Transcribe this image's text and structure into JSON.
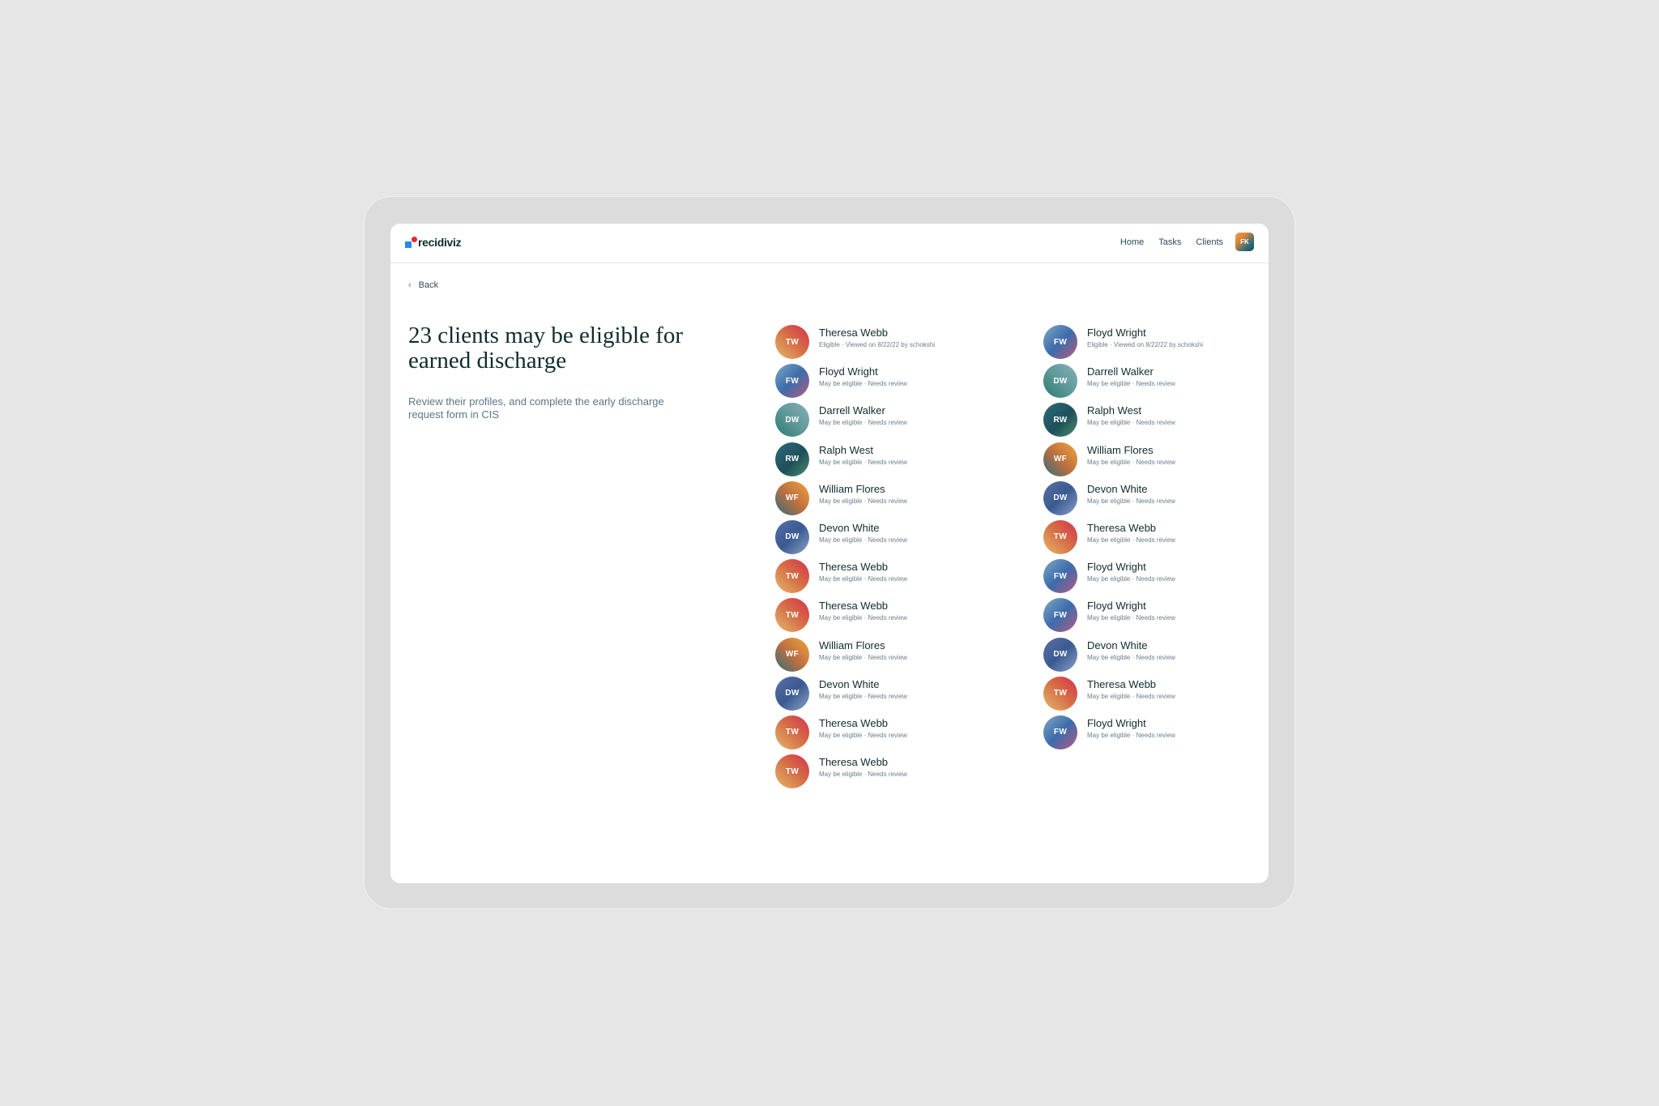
{
  "header": {
    "logo_text": "recidiviz",
    "nav": [
      {
        "label": "Home"
      },
      {
        "label": "Tasks"
      },
      {
        "label": "Clients"
      }
    ],
    "user_initials": "FK"
  },
  "back_label": "Back",
  "headline": "23 clients may be eligible for earned discharge",
  "subtext": "Review their profiles, and complete the early discharge request form in CIS",
  "clients_left": [
    {
      "initials": "TW",
      "name": "Theresa Webb",
      "status": "Eligible · Viewed on 8/22/22 by schokshi"
    },
    {
      "initials": "FW",
      "name": "Floyd Wright",
      "status": "May be eligible · Needs review"
    },
    {
      "initials": "DW",
      "name": "Darrell Walker",
      "status": "May be eligible · Needs review"
    },
    {
      "initials": "RW",
      "name": "Ralph West",
      "status": "May be eligible · Needs review"
    },
    {
      "initials": "WF",
      "name": "William Flores",
      "status": "May be eligible · Needs review"
    },
    {
      "initials": "DW",
      "name": "Devon White",
      "status": "May be eligible · Needs review"
    },
    {
      "initials": "TW",
      "name": "Theresa Webb",
      "status": "May be eligible · Needs review"
    },
    {
      "initials": "TW",
      "name": "Theresa Webb",
      "status": "May be eligible · Needs review"
    },
    {
      "initials": "WF",
      "name": "William Flores",
      "status": "May be eligible · Needs review"
    },
    {
      "initials": "DW",
      "name": "Devon White",
      "status": "May be eligible · Needs review"
    },
    {
      "initials": "TW",
      "name": "Theresa Webb",
      "status": "May be eligible · Needs review"
    },
    {
      "initials": "TW",
      "name": "Theresa Webb",
      "status": "May be eligible · Needs review"
    }
  ],
  "clients_right": [
    {
      "initials": "FW",
      "name": "Floyd Wright",
      "status": "Eligible · Viewed on 8/22/22 by schokshi"
    },
    {
      "initials": "DW",
      "name": "Darrell Walker",
      "status": "May be eligible · Needs review"
    },
    {
      "initials": "RW",
      "name": "Ralph West",
      "status": "May be eligible · Needs review"
    },
    {
      "initials": "WF",
      "name": "William Flores",
      "status": "May be eligible · Needs review"
    },
    {
      "initials": "DW",
      "name": "Devon White",
      "status": "May be eligible · Needs review"
    },
    {
      "initials": "TW",
      "name": "Theresa Webb",
      "status": "May be eligible · Needs review"
    },
    {
      "initials": "FW",
      "name": "Floyd Wright",
      "status": "May be eligible · Needs review"
    },
    {
      "initials": "FW",
      "name": "Floyd Wright",
      "status": "May be eligible · Needs review"
    },
    {
      "initials": "DW",
      "name": "Devon White",
      "status": "May be eligible · Needs review"
    },
    {
      "initials": "TW",
      "name": "Theresa Webb",
      "status": "May be eligible · Needs review"
    },
    {
      "initials": "FW",
      "name": "Floyd Wright",
      "status": "May be eligible · Needs review"
    }
  ]
}
